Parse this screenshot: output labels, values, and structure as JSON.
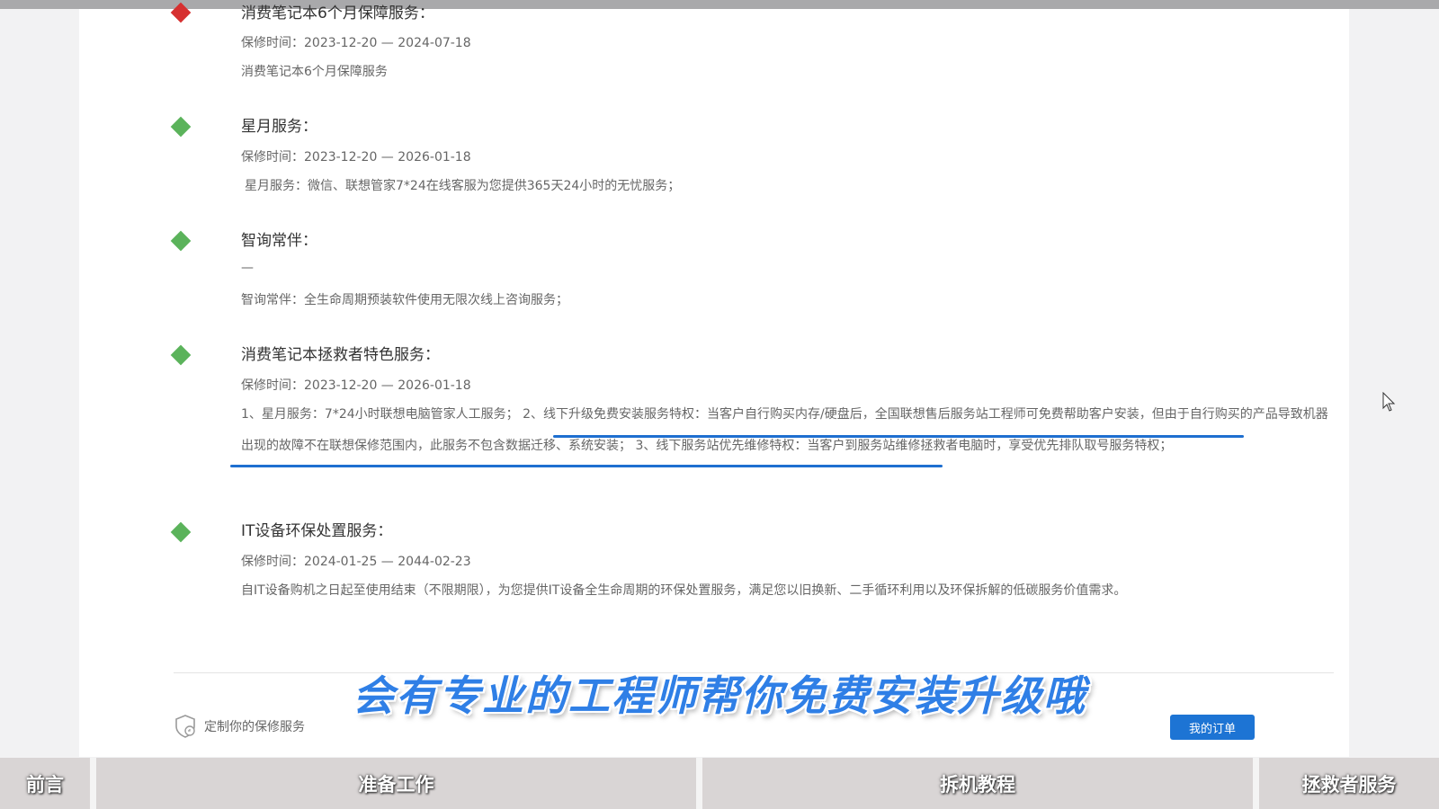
{
  "services": [
    {
      "title": "消费笔记本6个月保障服务：",
      "period_label": "保修时间：",
      "period": "2023-12-20 — 2024-07-18",
      "description": "消费笔记本6个月保障服务",
      "icon": "red-diamond"
    },
    {
      "title": "星月服务：",
      "period_label": "保修时间：",
      "period": "2023-12-20 — 2026-01-18",
      "description": "星月服务：微信、联想管家7*24在线客服为您提供365天24小时的无忧服务；",
      "icon": "green-diamond"
    },
    {
      "title": "智询常伴：",
      "period": "—",
      "description": "智询常伴：全生命周期预装软件使用无限次线上咨询服务；",
      "icon": "green-diamond"
    },
    {
      "title": "消费笔记本拯救者特色服务：",
      "period_label": "保修时间：",
      "period": "2023-12-20 — 2026-01-18",
      "description": "1、星月服务：7*24小时联想电脑管家人工服务； 2、线下升级免费安装服务特权：当客户自行购买内存/硬盘后，全国联想售后服务站工程师可免费帮助客户安装，但由于自行购买的产品导致机器出现的故障不在联想保修范围内，此服务不包含数据迁移、系统安装； 3、线下服务站优先维修特权：当客户到服务站维修拯救者电脑时，享受优先排队取号服务特权；",
      "icon": "green-diamond"
    },
    {
      "title": "IT设备环保处置服务：",
      "period_label": "保修时间：",
      "period": "2024-01-25 — 2044-02-23",
      "description": "自IT设备购机之日起至使用结束（不限期限），为您提供IT设备全生命周期的环保处置服务，满足您以旧换新、二手循环利用以及环保拆解的低碳服务价值需求。",
      "icon": "green-diamond"
    }
  ],
  "footer": {
    "custom_service": "定制你的保修服务",
    "order_button": "我的订单"
  },
  "caption": "会有专业的工程师帮你免费安装升级哦",
  "chapters": [
    "前言",
    "准备工作",
    "拆机教程",
    "拯救者服务"
  ],
  "colors": {
    "accent_blue": "#1d74d4",
    "diamond_green": "#5bb35b",
    "diamond_red": "#d63030",
    "underline_blue": "#1e6fd0"
  }
}
